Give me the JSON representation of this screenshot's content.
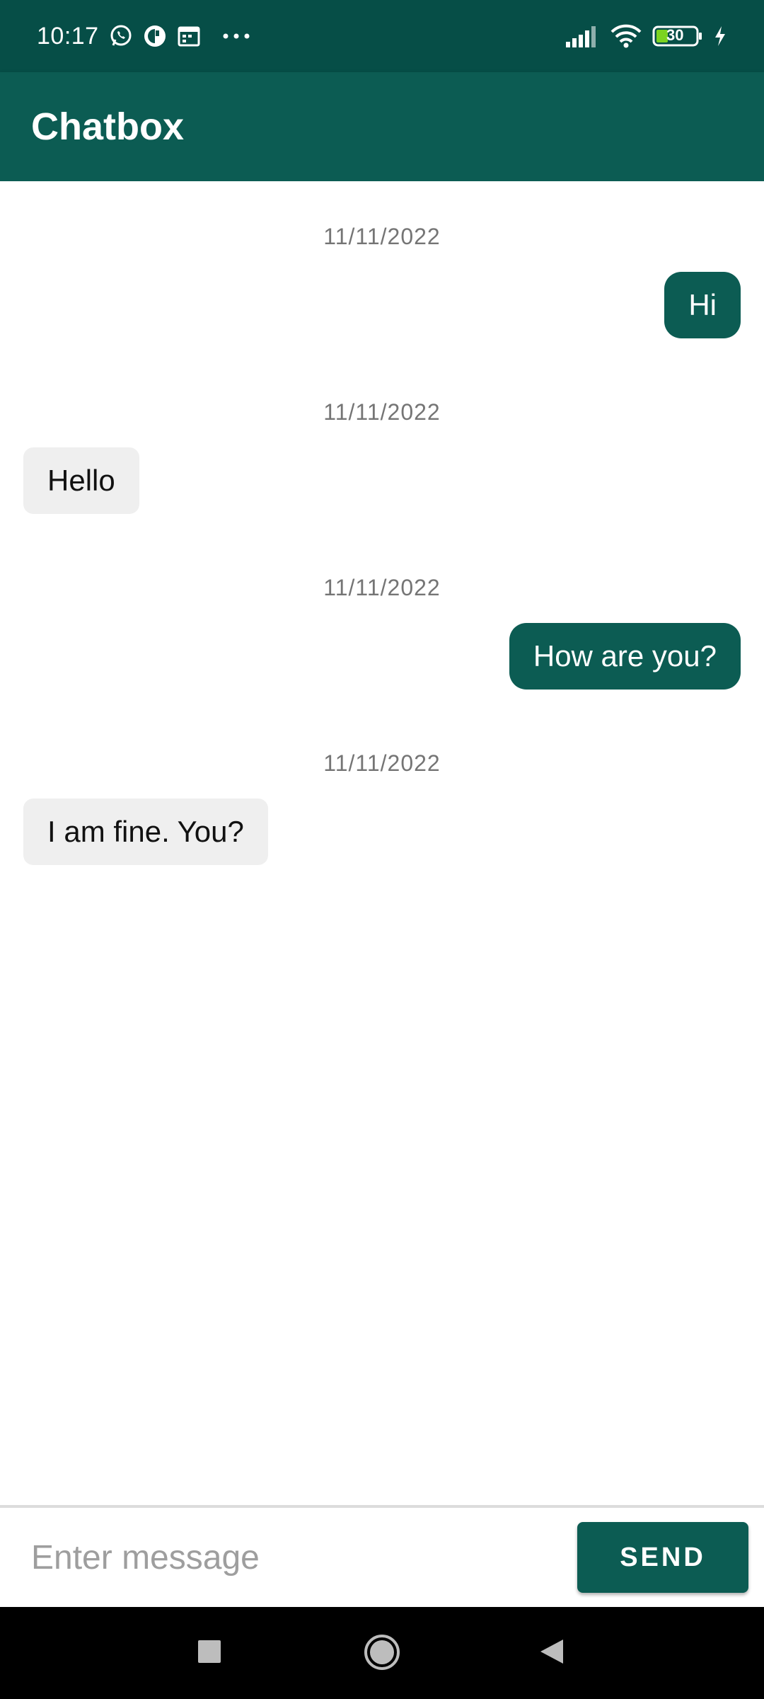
{
  "status_bar": {
    "time": "10:17",
    "battery_level": "30",
    "left_icons": [
      "whatsapp-icon",
      "app-c-icon",
      "calendar-icon",
      "more-dots-icon"
    ],
    "right_icons": [
      "signal-icon",
      "wifi-icon",
      "battery-icon",
      "charging-icon"
    ]
  },
  "app_bar": {
    "title": "Chatbox"
  },
  "messages": [
    {
      "date": "11/11/2022",
      "text": "Hi",
      "direction": "outgoing"
    },
    {
      "date": "11/11/2022",
      "text": "Hello",
      "direction": "incoming"
    },
    {
      "date": "11/11/2022",
      "text": "How are you?",
      "direction": "outgoing"
    },
    {
      "date": "11/11/2022",
      "text": "I am fine. You?",
      "direction": "incoming"
    }
  ],
  "input_bar": {
    "placeholder": "Enter message",
    "value": "",
    "send_label": "SEND"
  },
  "nav_bar": {
    "buttons": [
      "recents-icon",
      "home-icon",
      "back-icon"
    ]
  },
  "colors": {
    "primary_dark": "#064e47",
    "primary": "#0c5c53",
    "incoming_bubble": "#efefef",
    "date_text": "#757575"
  }
}
